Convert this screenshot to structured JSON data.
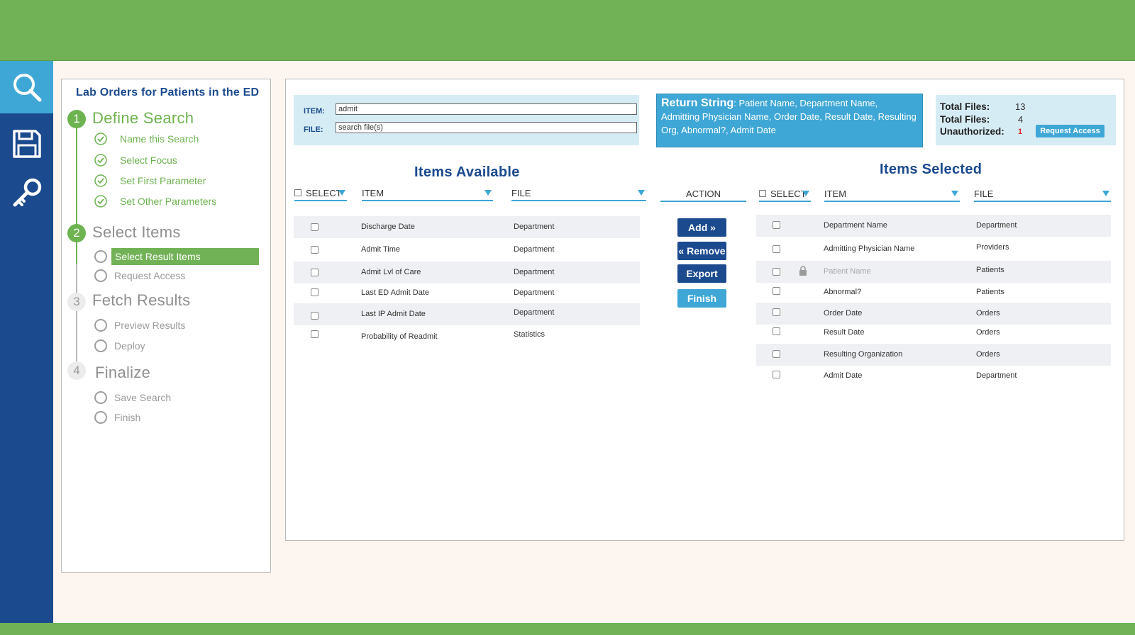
{
  "colors": {
    "green": "#72b257",
    "navy": "#1b4a8e",
    "blue": "#3fa7d6"
  },
  "sidebar": {
    "items": [
      {
        "icon": "search-icon",
        "active": true
      },
      {
        "icon": "save-icon",
        "active": false
      },
      {
        "icon": "key-icon",
        "active": false
      }
    ]
  },
  "wizard": {
    "title": "Lab Orders for Patients in the ED",
    "steps": [
      {
        "number": "1",
        "title": "Define Search",
        "items": [
          "Name this Search",
          "Select Focus",
          "Set First Parameter",
          "Set Other Parameters"
        ]
      },
      {
        "number": "2",
        "title": "Select Items",
        "items": [
          "Select Result Items",
          "Request Access"
        ]
      },
      {
        "number": "3",
        "title": "Fetch Results",
        "items": [
          "Preview Results",
          "Deploy"
        ]
      },
      {
        "number": "4",
        "title": "Finalize",
        "items": [
          "Save Search",
          "Finish"
        ]
      }
    ]
  },
  "search": {
    "item_label": "ITEM:",
    "item_value": "admit",
    "file_label": "FILE:",
    "file_value": "search file(s)"
  },
  "return_string": {
    "label": "Return String",
    "value": ": Patient Name, Department Name, Admitting Physician Name, Order Date, Result Date, Resulting Org, Abnormal?, Admit Date"
  },
  "totals": {
    "total_files_label_1": "Total Files:",
    "total_files_value_1": "13",
    "total_files_label_2": "Total Files:",
    "total_files_value_2": "4",
    "unauthorized_label": "Unauthorized:",
    "unauthorized_value": "1",
    "request_access_label": "Request Access"
  },
  "available": {
    "title": "Items Available",
    "headers": {
      "select": "SELECT",
      "item": "ITEM",
      "file": "FILE"
    },
    "rows": [
      {
        "item": "Discharge Date",
        "file": "Department"
      },
      {
        "item": "Admit Time",
        "file": "Department"
      },
      {
        "item": "Admit Lvl of Care",
        "file": "Department"
      },
      {
        "item": "Last ED Admit Date",
        "file": "Department"
      },
      {
        "item": "Last IP Admit Date",
        "file": "Department"
      },
      {
        "item": "Probability of Readmit",
        "file": "Statistics"
      }
    ]
  },
  "actions": {
    "header": "ACTION",
    "add": "Add »",
    "remove": "« Remove",
    "export": "Export",
    "finish": "Finish"
  },
  "selected": {
    "title": "Items Selected",
    "headers": {
      "select": "SELECT",
      "item": "ITEM",
      "file": "FILE"
    },
    "rows": [
      {
        "item": "Department Name",
        "file": "Department"
      },
      {
        "item": "Admitting Physician Name",
        "file": "Providers"
      },
      {
        "item": "Patient Name",
        "file": "Patients",
        "locked": true
      },
      {
        "item": "Abnormal?",
        "file": "Patients"
      },
      {
        "item": "Order Date",
        "file": "Orders"
      },
      {
        "item": "Result Date",
        "file": "Orders"
      },
      {
        "item": "Resulting Organization",
        "file": "Orders"
      },
      {
        "item": "Admit Date",
        "file": "Department"
      }
    ]
  }
}
